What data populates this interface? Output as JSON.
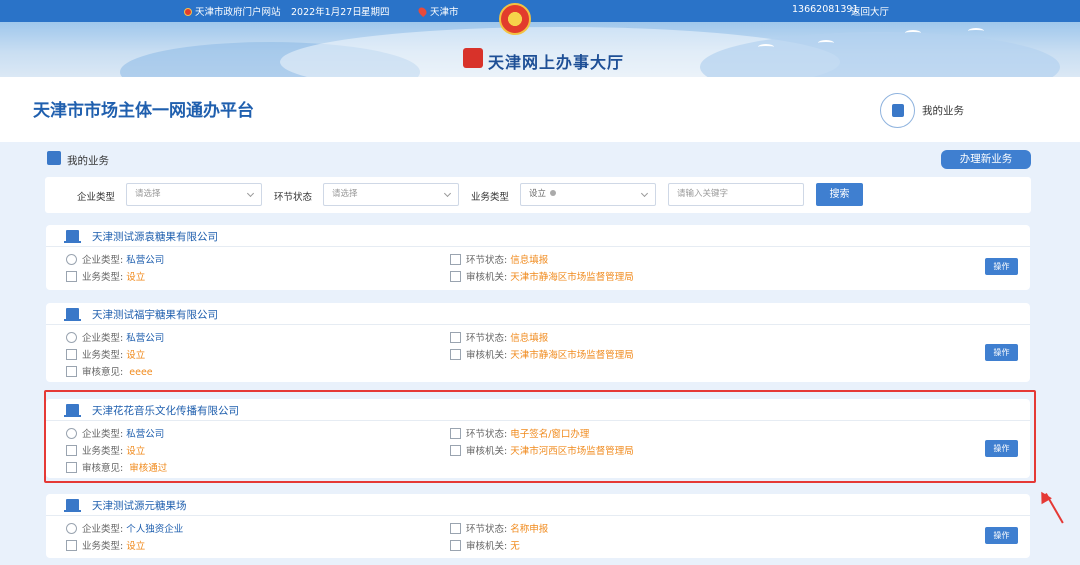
{
  "topbar": {
    "portal": "天津市政府门户网站",
    "date": "2022年1月27日",
    "weekday": "星期四",
    "city": "天津市",
    "phone": "13662081391",
    "back": "返回大厅"
  },
  "banner": {
    "logo_text": "天津网上办事大厅"
  },
  "header": {
    "page_title": "天津市市场主体一网通办平台",
    "my_business": "我的业务"
  },
  "section": {
    "title": "我的业务",
    "new_button": "办理新业务"
  },
  "filters": {
    "enterprise_type_label": "企业类型",
    "enterprise_type_value": "请选择",
    "stage_label": "环节状态",
    "stage_value": "请选择",
    "biz_type_label": "业务类型",
    "biz_type_value": "设立",
    "keyword_placeholder": "请输入关键字",
    "search_button": "搜索"
  },
  "labels": {
    "enterprise_type": "企业类型:",
    "biz_type": "业务类型:",
    "review_opinion": "审核意见:",
    "stage_status": "环节状态:",
    "review_org": "审核机关:",
    "operate": "操作"
  },
  "cards": [
    {
      "name": "天津测试源袁糖果有限公司",
      "enterprise_type": "私营公司",
      "biz_type": "设立",
      "review_opinion": "",
      "stage_status": "信息填报",
      "review_org": "天津市静海区市场监督管理局"
    },
    {
      "name": "天津测试福宇糖果有限公司",
      "enterprise_type": "私营公司",
      "biz_type": "设立",
      "review_opinion": "eeee",
      "stage_status": "信息填报",
      "review_org": "天津市静海区市场监督管理局"
    },
    {
      "name": "天津花花音乐文化传播有限公司",
      "enterprise_type": "私营公司",
      "biz_type": "设立",
      "review_opinion": "审核通过",
      "stage_status": "电子签名/窗口办理",
      "review_org": "天津市河西区市场监督管理局"
    },
    {
      "name": "天津测试源元糖果场",
      "enterprise_type": "个人独资企业",
      "biz_type": "设立",
      "review_opinion": "",
      "stage_status": "名称申报",
      "review_org": "无"
    }
  ],
  "colors": {
    "primary": "#3f7fd0",
    "title_blue": "#1f5fae",
    "orange": "#f08a1c",
    "highlight": "#e53935"
  }
}
